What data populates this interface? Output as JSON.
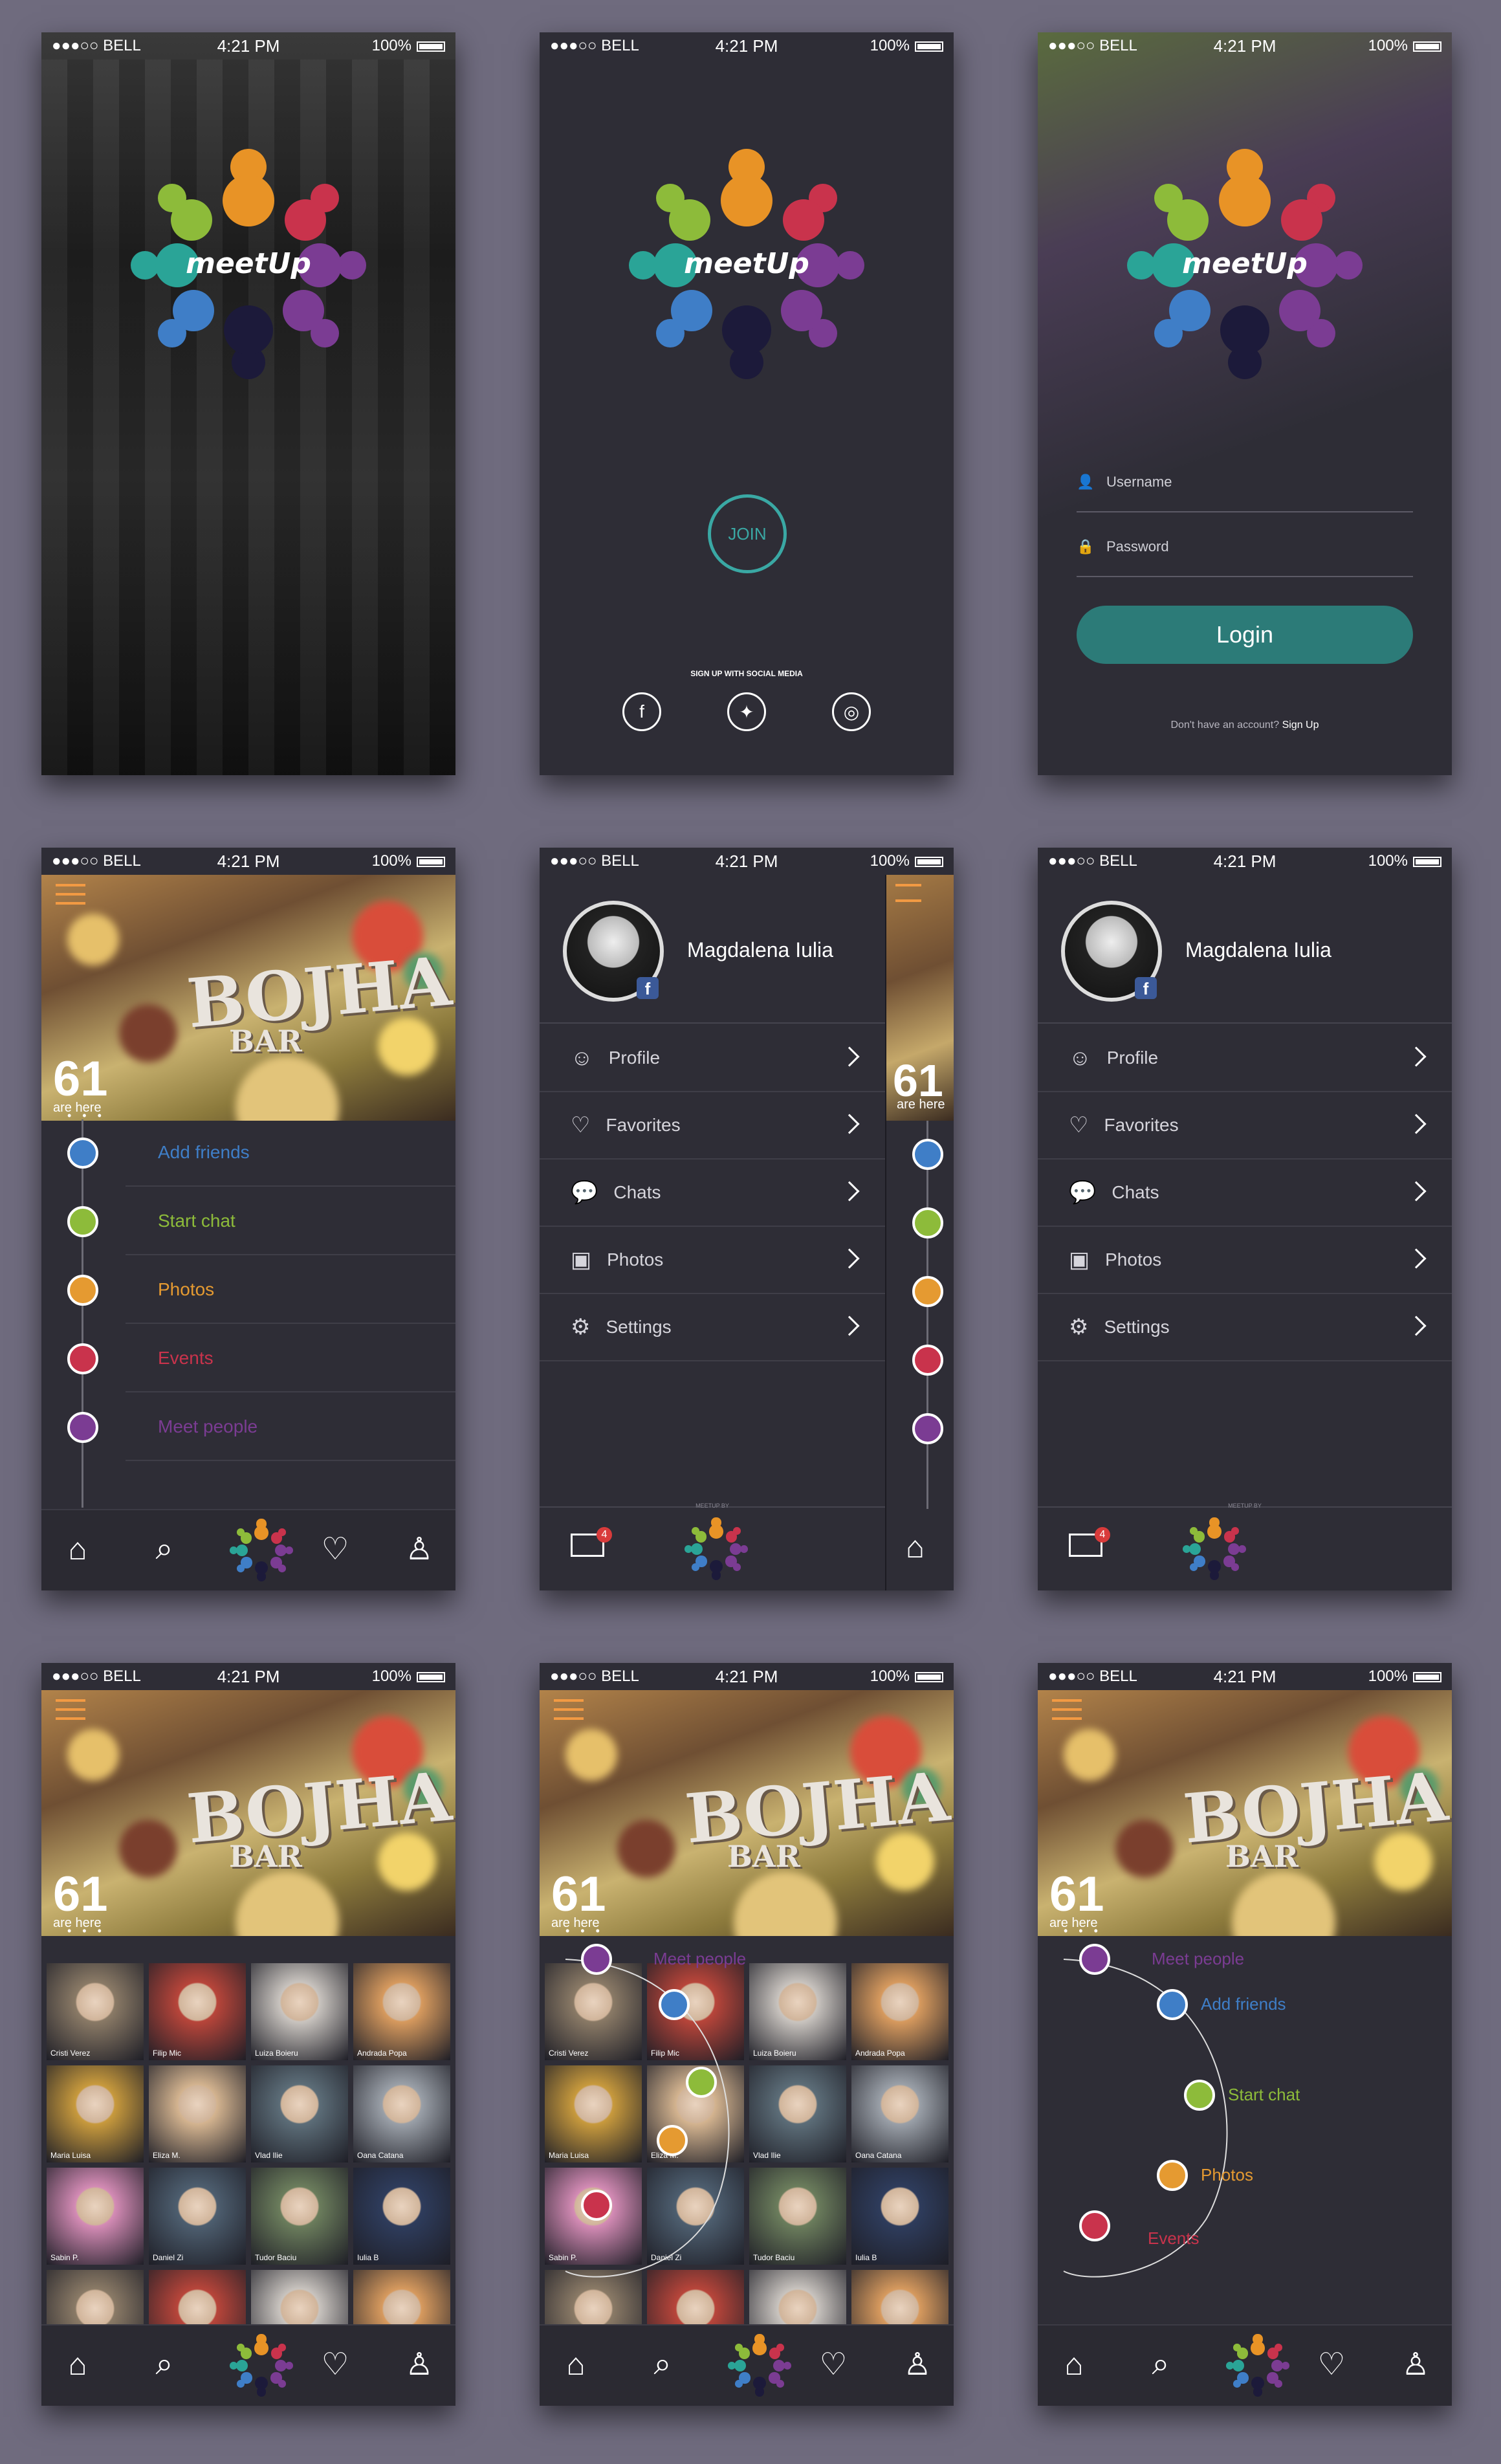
{
  "status": {
    "carrier": "BELL",
    "time": "4:21 PM",
    "battery": "100%"
  },
  "brand": {
    "logo_text": "meetUp"
  },
  "splash": {},
  "join_screen": {
    "join_label": "JOIN",
    "social_caption": "SIGN UP WITH SOCIAL MEDIA",
    "social": [
      "facebook-icon",
      "twitter-icon",
      "instagram-icon"
    ]
  },
  "login": {
    "username_placeholder": "Username",
    "password_placeholder": "Password",
    "login_label": "Login",
    "no_account": "Don't have an account?",
    "signup_link": "Sign Up"
  },
  "venue": {
    "sign_title": "BOJHA",
    "sign_sub": "BAR",
    "count": "61",
    "count_label": "are here",
    "page_dots": "• • •"
  },
  "timeline": {
    "items": [
      {
        "label": "Add friends",
        "color": "#3f7ec7"
      },
      {
        "label": "Start chat",
        "color": "#8dbb3a"
      },
      {
        "label": "Photos",
        "color": "#e59a31"
      },
      {
        "label": "Events",
        "color": "#c9334c"
      },
      {
        "label": "Meet people",
        "color": "#7b3c93"
      }
    ]
  },
  "profile": {
    "name": "Magdalena Iulia",
    "badge": "f",
    "menu": [
      "Profile",
      "Favorites",
      "Chats",
      "Photos",
      "Settings"
    ],
    "inbox_count": "4",
    "footer_caption": "MEETUP BY"
  },
  "people": [
    {
      "name": "Cristi Verez"
    },
    {
      "name": "Filip Mic"
    },
    {
      "name": "Luiza Boieru"
    },
    {
      "name": "Andrada Popa"
    },
    {
      "name": "Maria Luisa"
    },
    {
      "name": "Eliza M."
    },
    {
      "name": "Vlad Ilie"
    },
    {
      "name": "Oana Catana"
    },
    {
      "name": "Sabin P."
    },
    {
      "name": "Daniel Zi"
    },
    {
      "name": "Tudor Baciu"
    },
    {
      "name": "Iulia B"
    }
  ],
  "colors": {
    "orange": "#e89326",
    "red": "#c9334c",
    "purple": "#7b3c93",
    "blue": "#3f7ec7",
    "green": "#8dbb3a",
    "teal": "#2aa497",
    "join_ring": "#3aa8a4"
  }
}
